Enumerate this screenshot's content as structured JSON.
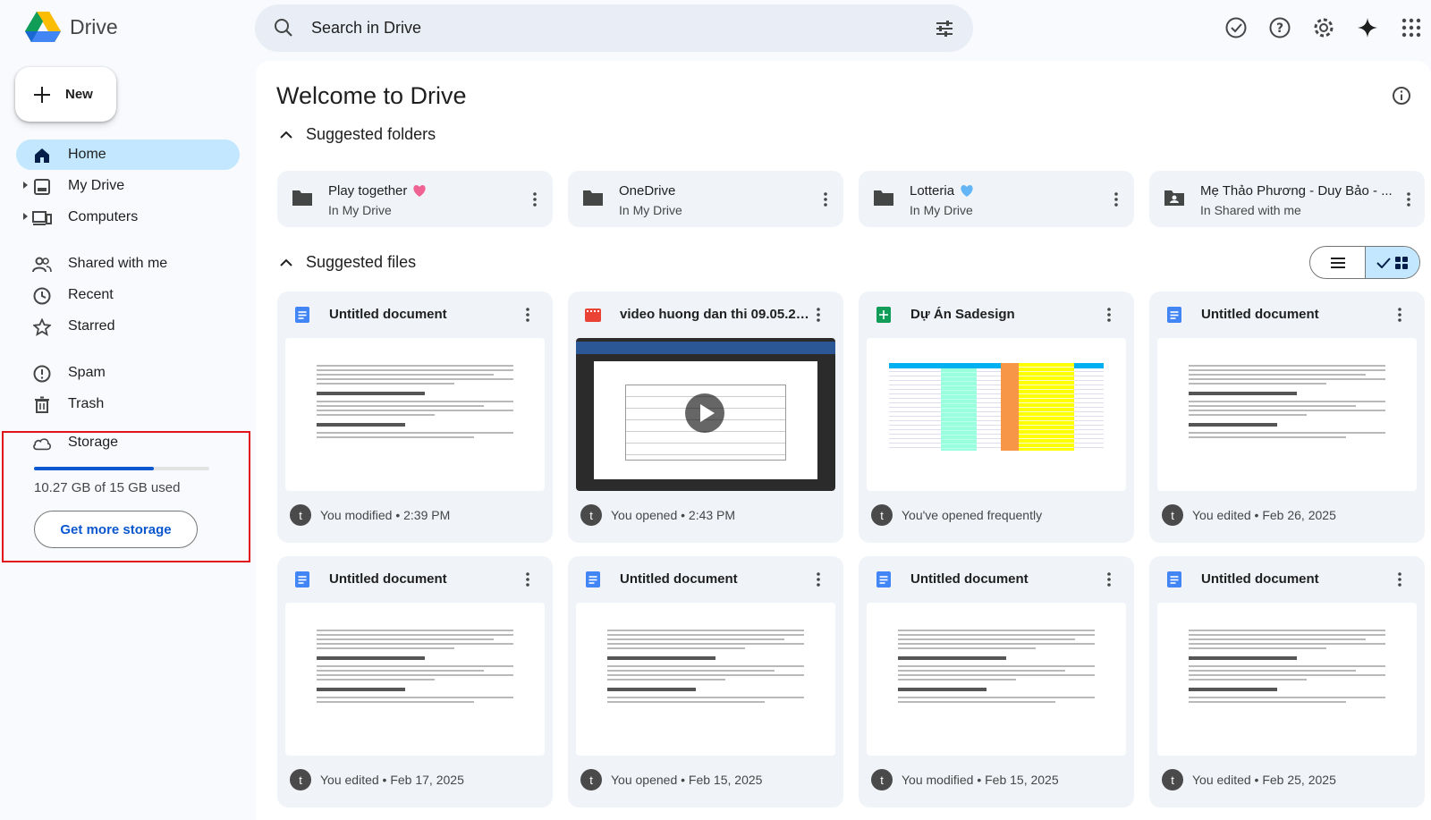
{
  "app": {
    "name": "Drive"
  },
  "search": {
    "placeholder": "Search in Drive"
  },
  "sidebar": {
    "new_label": "New",
    "items": [
      {
        "label": "Home",
        "icon": "home-icon",
        "active": true
      },
      {
        "label": "My Drive",
        "icon": "my-drive-icon"
      },
      {
        "label": "Computers",
        "icon": "computers-icon"
      },
      {
        "label": "Shared with me",
        "icon": "shared-icon"
      },
      {
        "label": "Recent",
        "icon": "clock-icon"
      },
      {
        "label": "Starred",
        "icon": "star-icon"
      },
      {
        "label": "Spam",
        "icon": "spam-icon"
      },
      {
        "label": "Trash",
        "icon": "trash-icon"
      },
      {
        "label": "Storage",
        "icon": "cloud-icon"
      }
    ],
    "storage": {
      "used_text": "10.27 GB of 15 GB used",
      "used_fraction": 0.685,
      "cta": "Get more storage"
    }
  },
  "main": {
    "title": "Welcome to Drive",
    "suggested_folders_label": "Suggested folders",
    "suggested_files_label": "Suggested files",
    "folders": [
      {
        "name": "Play together",
        "location": "In My Drive",
        "emoji": "heart-pink"
      },
      {
        "name": "OneDrive",
        "location": "In My Drive"
      },
      {
        "name": "Lotteria",
        "location": "In My Drive",
        "emoji": "heart-blue"
      },
      {
        "name": "Mẹ Thảo Phương - Duy Bảo - ...",
        "location": "In Shared with me"
      }
    ],
    "files": [
      {
        "name": "Untitled document",
        "type": "doc",
        "meta": "You modified • 2:39 PM",
        "avatar": "t"
      },
      {
        "name": "video huong dan thi 09.05.20...",
        "type": "video",
        "meta": "You opened • 2:43 PM",
        "avatar": "t"
      },
      {
        "name": "Dự Án Sadesign",
        "type": "sheet",
        "meta": "You've opened frequently",
        "avatar": "t"
      },
      {
        "name": "Untitled document",
        "type": "doc",
        "meta": "You edited • Feb 26, 2025",
        "avatar": "t"
      },
      {
        "name": "Untitled document",
        "type": "doc",
        "meta": "You edited • Feb 17, 2025",
        "avatar": "t"
      },
      {
        "name": "Untitled document",
        "type": "doc",
        "meta": "You opened • Feb 15, 2025",
        "avatar": "t"
      },
      {
        "name": "Untitled document",
        "type": "doc",
        "meta": "You modified • Feb 15, 2025",
        "avatar": "t"
      },
      {
        "name": "Untitled document",
        "type": "doc",
        "meta": "You edited • Feb 25, 2025",
        "avatar": "t"
      }
    ]
  },
  "colors": {
    "accent": "#0b57d0",
    "active_bg": "#c2e7ff",
    "highlight": "#e1141c"
  }
}
